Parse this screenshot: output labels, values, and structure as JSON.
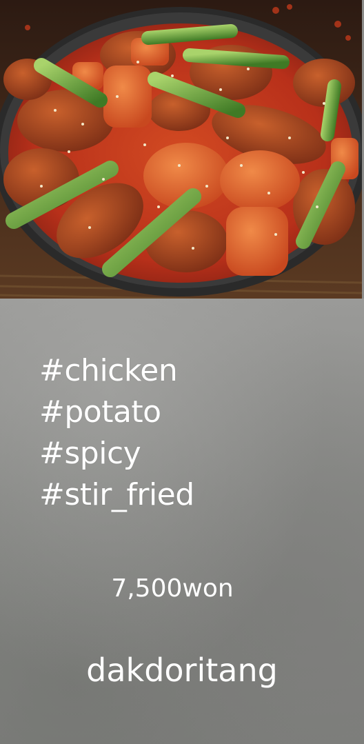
{
  "photo": {
    "icon": "food-photo-dakdoritang"
  },
  "hashtags": [
    "#chicken",
    "#potato",
    "#spicy",
    "#stir_fried"
  ],
  "price": "7,500won",
  "dish_name": "dakdoritang",
  "colors": {
    "text": "#ffffff",
    "panel": "#8d8d8b",
    "sauce": "#c0391b",
    "scallion": "#6aa83a"
  }
}
